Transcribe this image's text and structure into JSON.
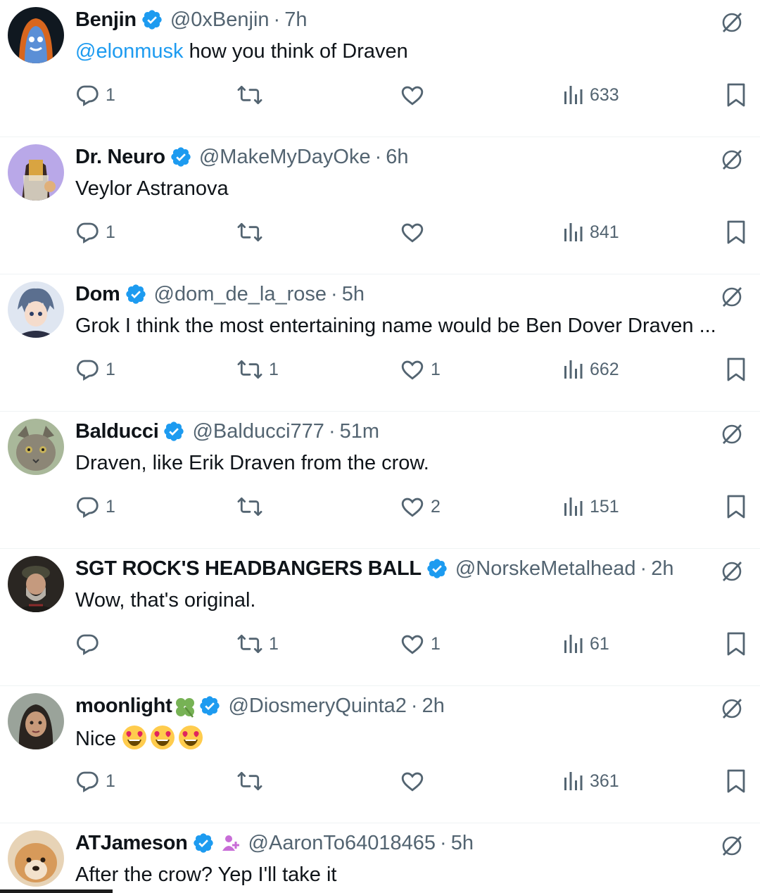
{
  "colors": {
    "accent": "#1d9bf0",
    "muted": "#536471",
    "text": "#0f1419",
    "divider": "#eff3f4"
  },
  "replies": [
    {
      "name": "Benjin",
      "handle": "@0xBenjin",
      "time": "7h",
      "mention": "@elonmusk",
      "text": " how you think of Draven",
      "reply_count": "1",
      "retweet_count": "",
      "like_count": "",
      "views": "633"
    },
    {
      "name": "Dr. Neuro",
      "handle": "@MakeMyDayOke",
      "time": "6h",
      "mention": "",
      "text": "Veylor Astranova",
      "reply_count": "1",
      "retweet_count": "",
      "like_count": "",
      "views": "841"
    },
    {
      "name": "Dom",
      "handle": "@dom_de_la_rose",
      "time": "5h",
      "mention": "",
      "text": "Grok I think the most entertaining name would be Ben Dover Draven ...",
      "reply_count": "1",
      "retweet_count": "1",
      "like_count": "1",
      "views": "662"
    },
    {
      "name": "Balducci",
      "handle": "@Balducci777",
      "time": "51m",
      "mention": "",
      "text": "Draven, like Erik Draven from the crow.",
      "reply_count": "1",
      "retweet_count": "",
      "like_count": "2",
      "views": "151"
    },
    {
      "name": "SGT ROCK'S HEADBANGERS BALL",
      "handle": "@NorskeMetalhead",
      "time": "2h",
      "mention": "",
      "text": "Wow, that's original.",
      "reply_count": "",
      "retweet_count": "1",
      "like_count": "1",
      "views": "61"
    },
    {
      "name": "moonlight",
      "name_emoji": "four-leaf-clover",
      "handle": "@DiosmeryQuinta2",
      "time": "2h",
      "mention": "",
      "text": "Nice",
      "emoji": [
        "heart-eyes",
        "heart-eyes",
        "heart-eyes"
      ],
      "reply_count": "1",
      "retweet_count": "",
      "like_count": "",
      "views": "361"
    },
    {
      "name": "ATJameson",
      "extra_badge": "affiliate-person-icon",
      "handle": "@AaronTo64018465",
      "time": "5h",
      "mention": "",
      "text": "After the crow? Yep I'll take it"
    }
  ],
  "separator": "·",
  "icons": {
    "reply": "reply-icon",
    "retweet": "retweet-icon",
    "like": "heart-icon",
    "views": "views-icon",
    "bookmark": "bookmark-icon",
    "grok": "grok-icon",
    "verified": "verified-badge-icon"
  }
}
